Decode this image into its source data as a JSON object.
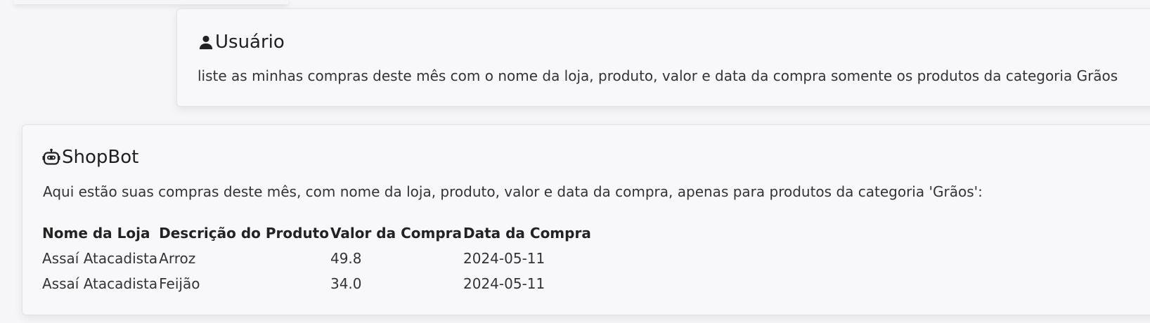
{
  "user_message": {
    "author": "Usuário",
    "icon": "user-icon",
    "text": "liste as minhas compras deste mês com o nome da loja, produto, valor e data da compra somente os produtos da categoria Grãos"
  },
  "bot_message": {
    "author": "ShopBot",
    "icon": "robot-icon",
    "intro": "Aqui estão suas compras deste mês, com nome da loja, produto, valor e data da compra, apenas para produtos da categoria 'Grãos':",
    "table": {
      "headers": [
        "Nome da Loja",
        "Descrição do Produto",
        "Valor da Compra",
        "Data da Compra"
      ],
      "rows": [
        [
          "Assaí Atacadista",
          "Arroz",
          "49.8",
          "2024-05-11"
        ],
        [
          "Assaí Atacadista",
          "Feijão",
          "34.0",
          "2024-05-11"
        ]
      ]
    }
  }
}
